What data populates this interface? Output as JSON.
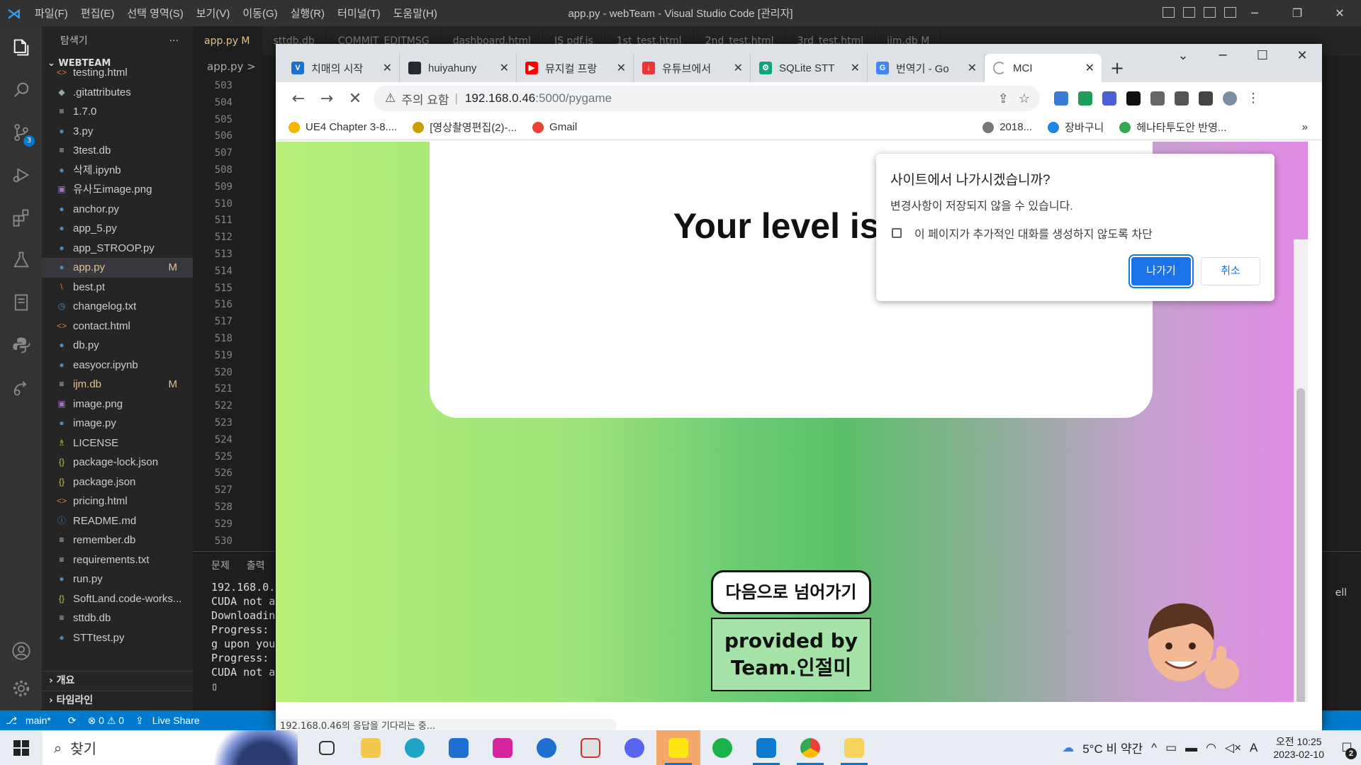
{
  "vscode": {
    "title": "app.py - webTeam - Visual Studio Code [관리자]",
    "menu": [
      "파일(F)",
      "편집(E)",
      "선택 영역(S)",
      "보기(V)",
      "이동(G)",
      "실행(R)",
      "터미널(T)",
      "도움말(H)"
    ],
    "explorer_label": "탐색기",
    "explorer_more": "···",
    "workspace": "WEBTEAM",
    "files": [
      {
        "name": "testing.html",
        "icon": "<>",
        "color": "#e37933",
        "mod": ""
      },
      {
        "name": ".gitattributes",
        "icon": "◆",
        "color": "#9aa",
        "mod": ""
      },
      {
        "name": "1.7.0",
        "icon": "≡",
        "color": "#ccc",
        "mod": ""
      },
      {
        "name": "3.py",
        "icon": "●",
        "color": "#4b8bbe",
        "mod": ""
      },
      {
        "name": "3test.db",
        "icon": "≡",
        "color": "#ccc",
        "mod": ""
      },
      {
        "name": "삭제.ipynb",
        "icon": "●",
        "color": "#4b8bbe",
        "mod": ""
      },
      {
        "name": "유사도image.png",
        "icon": "▣",
        "color": "#a074c4",
        "mod": ""
      },
      {
        "name": "anchor.py",
        "icon": "●",
        "color": "#4b8bbe",
        "mod": ""
      },
      {
        "name": "app_5.py",
        "icon": "●",
        "color": "#4b8bbe",
        "mod": ""
      },
      {
        "name": "app_STROOP.py",
        "icon": "●",
        "color": "#4b8bbe",
        "mod": ""
      },
      {
        "name": "app.py",
        "icon": "●",
        "color": "#4b8bbe",
        "mod": "M"
      },
      {
        "name": "best.pt",
        "icon": "\\",
        "color": "#e37933",
        "mod": ""
      },
      {
        "name": "changelog.txt",
        "icon": "◷",
        "color": "#4b8bbe",
        "mod": ""
      },
      {
        "name": "contact.html",
        "icon": "<>",
        "color": "#e37933",
        "mod": ""
      },
      {
        "name": "db.py",
        "icon": "●",
        "color": "#4b8bbe",
        "mod": ""
      },
      {
        "name": "easyocr.ipynb",
        "icon": "●",
        "color": "#4b8bbe",
        "mod": ""
      },
      {
        "name": "ijm.db",
        "icon": "≡",
        "color": "#ccc",
        "mod": "M"
      },
      {
        "name": "image.png",
        "icon": "▣",
        "color": "#a074c4",
        "mod": ""
      },
      {
        "name": "image.py",
        "icon": "●",
        "color": "#4b8bbe",
        "mod": ""
      },
      {
        "name": "LICENSE",
        "icon": "♗",
        "color": "#cbcb41",
        "mod": ""
      },
      {
        "name": "package-lock.json",
        "icon": "{}",
        "color": "#cbcb41",
        "mod": ""
      },
      {
        "name": "package.json",
        "icon": "{}",
        "color": "#cbcb41",
        "mod": ""
      },
      {
        "name": "pricing.html",
        "icon": "<>",
        "color": "#e37933",
        "mod": ""
      },
      {
        "name": "README.md",
        "icon": "ⓘ",
        "color": "#4b8bbe",
        "mod": ""
      },
      {
        "name": "remember.db",
        "icon": "≡",
        "color": "#ccc",
        "mod": ""
      },
      {
        "name": "requirements.txt",
        "icon": "≡",
        "color": "#ccc",
        "mod": ""
      },
      {
        "name": "run.py",
        "icon": "●",
        "color": "#4b8bbe",
        "mod": ""
      },
      {
        "name": "SoftLand.code-works...",
        "icon": "{}",
        "color": "#cbcb41",
        "mod": ""
      },
      {
        "name": "sttdb.db",
        "icon": "≡",
        "color": "#ccc",
        "mod": ""
      },
      {
        "name": "STTtest.py",
        "icon": "●",
        "color": "#4b8bbe",
        "mod": ""
      }
    ],
    "outline_label": "개요",
    "timeline_label": "타임라인",
    "editor_tabs": [
      "app.py  M",
      "sttdb.db",
      "COMMIT_EDITMSG",
      "dashboard.html",
      "JS pdf.js",
      "1st_test.html",
      "2nd_test.html",
      "3rd_test.html",
      "ijm.db  M"
    ],
    "breadcrumb": "app.py >",
    "line_numbers": [
      "503",
      "504",
      "505",
      "506",
      "507",
      "508",
      "509",
      "510",
      "511",
      "512",
      "513",
      "514",
      "515",
      "516",
      "517",
      "518",
      "519",
      "520",
      "521",
      "522",
      "523",
      "524",
      "525",
      "526",
      "527",
      "528",
      "529",
      "530"
    ],
    "terminal_tabs": [
      "문제",
      "출력"
    ],
    "terminal_text": "192.168.0.4\nCUDA not av\nDownloading\nProgress: \ng upon your\nProgress: \nCUDA not av\n▯",
    "terminal_right": "ell",
    "status": {
      "branch": "main*",
      "sync": "⟳",
      "problems": "⊗ 0 ⚠ 0",
      "live_share": "Live Share"
    },
    "source_control_badge": "3"
  },
  "chrome": {
    "tabs": [
      {
        "title": "치매의 시작",
        "color": "#1d6fd1",
        "glyph": "V"
      },
      {
        "title": "huiyahuny",
        "color": "#24292f",
        "glyph": ""
      },
      {
        "title": "뮤지컬 프랑",
        "color": "#ff0000",
        "glyph": "▶"
      },
      {
        "title": "유튜브에서",
        "color": "#e53935",
        "glyph": "↓"
      },
      {
        "title": "SQLite STT",
        "color": "#10a37f",
        "glyph": "⚙"
      },
      {
        "title": "번역기 - Go",
        "color": "#4285f4",
        "glyph": "G"
      },
      {
        "title": "MCI",
        "color": "#9aa0a6",
        "glyph": ""
      }
    ],
    "new_tab": "+",
    "security_label": "주의 요함",
    "url_host": "192.168.0.46",
    "url_path": ":5000/pygame",
    "bookmarks": [
      {
        "label": "UE4 Chapter 3-8....",
        "color": "#f4b400"
      },
      {
        "label": "[영상촬영편집(2)-...",
        "color": "#c8a000"
      },
      {
        "label": "Gmail",
        "color": "#ea4335"
      },
      {
        "label": "2018...",
        "color": "#777"
      },
      {
        "label": "장바구니",
        "color": "#1e88e5"
      },
      {
        "label": "헤나타투도안 반영...",
        "color": "#34a853"
      }
    ],
    "bookmarks_more": "»",
    "status_bubble": "192.168.0.46의 응답을 기다리는 중..."
  },
  "page": {
    "level_text": "Your level is 1",
    "next_button": "다음으로 넘어가기",
    "provided_line1": "provided by",
    "provided_line2": "Team.인절미"
  },
  "dialog": {
    "title": "사이트에서 나가시겠습니까?",
    "message": "변경사항이 저장되지 않을 수 있습니다.",
    "checkbox_label": "이 페이지가 추가적인 대화를 생성하지 않도록 차단",
    "leave_button": "나가기",
    "cancel_button": "취소"
  },
  "taskbar": {
    "search_label": "찾기",
    "weather": "5°C  비 약간",
    "time": "오전 10:25",
    "date": "2023-02-10",
    "ime": "A",
    "notification_count": "2"
  }
}
